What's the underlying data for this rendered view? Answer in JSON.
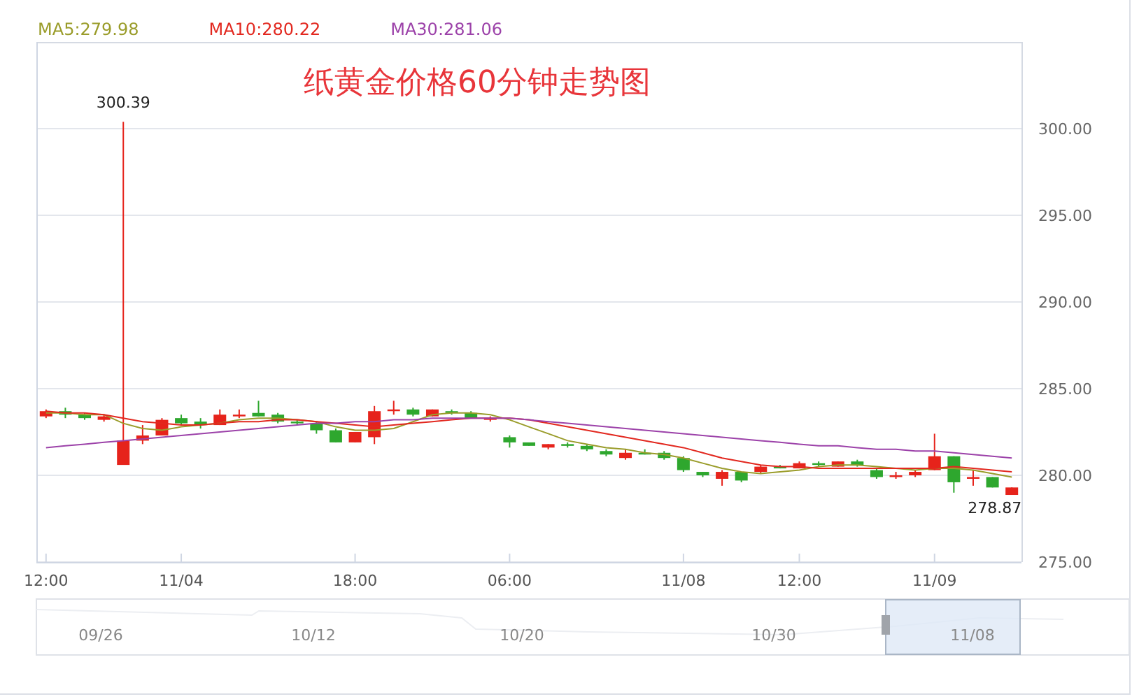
{
  "chart_data": {
    "type": "candlestick",
    "title": "纸黄金价格60分钟走势图",
    "grid": true,
    "ylim": [
      275,
      305
    ],
    "yticks": [
      {
        "value": 275,
        "label": "275.00"
      },
      {
        "value": 280,
        "label": "280.00"
      },
      {
        "value": 285,
        "label": "285.00"
      },
      {
        "value": 290,
        "label": "290.00"
      },
      {
        "value": 295,
        "label": "295.00"
      },
      {
        "value": 300,
        "label": "300.00"
      }
    ],
    "categories": [
      "12:00",
      null,
      null,
      null,
      null,
      null,
      null,
      "11/04",
      null,
      null,
      null,
      null,
      null,
      null,
      null,
      null,
      "18:00",
      null,
      null,
      null,
      null,
      null,
      null,
      null,
      "06:00",
      null,
      null,
      null,
      null,
      null,
      null,
      null,
      null,
      "11/08",
      null,
      null,
      null,
      null,
      null,
      "12:00",
      null,
      null,
      null,
      null,
      null,
      null,
      "11/09",
      null,
      null,
      null,
      null
    ],
    "ohlc": [
      [
        283.4,
        283.8,
        283.3,
        283.7
      ],
      [
        283.7,
        283.9,
        283.3,
        283.5
      ],
      [
        283.5,
        283.6,
        283.2,
        283.3
      ],
      [
        283.2,
        283.5,
        283.1,
        283.4
      ],
      [
        280.6,
        300.39,
        280.6,
        282.0
      ],
      [
        282.0,
        282.9,
        281.8,
        282.3
      ],
      [
        282.3,
        283.3,
        282.3,
        283.2
      ],
      [
        283.3,
        283.5,
        282.9,
        283.0
      ],
      [
        283.1,
        283.3,
        282.7,
        282.9
      ],
      [
        282.9,
        283.8,
        282.9,
        283.5
      ],
      [
        283.4,
        283.8,
        283.3,
        283.5
      ],
      [
        283.6,
        284.3,
        283.4,
        283.4
      ],
      [
        283.5,
        283.6,
        283.0,
        283.1
      ],
      [
        283.1,
        283.2,
        282.9,
        283.0
      ],
      [
        283.0,
        283.1,
        282.4,
        282.6
      ],
      [
        282.6,
        282.7,
        281.9,
        281.9
      ],
      [
        281.9,
        282.5,
        281.9,
        282.5
      ],
      [
        282.2,
        284.0,
        281.8,
        283.7
      ],
      [
        283.7,
        284.3,
        283.5,
        283.8
      ],
      [
        283.8,
        283.9,
        283.4,
        283.5
      ],
      [
        283.4,
        283.8,
        283.4,
        283.8
      ],
      [
        283.7,
        283.8,
        283.5,
        283.6
      ],
      [
        283.6,
        283.7,
        283.3,
        283.3
      ],
      [
        283.2,
        283.4,
        283.1,
        283.3
      ],
      [
        282.2,
        282.3,
        281.6,
        281.9
      ],
      [
        281.9,
        281.9,
        281.7,
        281.7
      ],
      [
        281.6,
        281.8,
        281.5,
        281.8
      ],
      [
        281.8,
        281.9,
        281.6,
        281.7
      ],
      [
        281.7,
        281.8,
        281.4,
        281.5
      ],
      [
        281.4,
        281.5,
        281.1,
        281.2
      ],
      [
        281.0,
        281.5,
        280.9,
        281.3
      ],
      [
        281.3,
        281.5,
        281.2,
        281.2
      ],
      [
        281.3,
        281.4,
        280.9,
        281.0
      ],
      [
        281.0,
        281.1,
        280.2,
        280.3
      ],
      [
        280.2,
        280.2,
        279.9,
        280.0
      ],
      [
        279.8,
        280.3,
        279.4,
        280.2
      ],
      [
        280.2,
        280.2,
        279.6,
        279.7
      ],
      [
        280.2,
        280.6,
        280.1,
        280.5
      ],
      [
        280.5,
        280.6,
        280.4,
        280.4
      ],
      [
        280.4,
        280.8,
        280.4,
        280.7
      ],
      [
        280.7,
        280.8,
        280.5,
        280.6
      ],
      [
        280.5,
        280.8,
        280.5,
        280.8
      ],
      [
        280.8,
        280.9,
        280.5,
        280.6
      ],
      [
        280.3,
        280.4,
        279.8,
        279.9
      ],
      [
        279.9,
        280.2,
        279.8,
        280.0
      ],
      [
        280.0,
        280.3,
        279.9,
        280.2
      ],
      [
        280.3,
        282.4,
        280.3,
        281.1
      ],
      [
        281.1,
        281.1,
        279.0,
        279.6
      ],
      [
        279.8,
        280.3,
        279.4,
        279.9
      ],
      [
        279.9,
        279.9,
        279.3,
        279.3
      ],
      [
        278.87,
        279.3,
        278.87,
        279.3
      ]
    ],
    "series": [
      {
        "name": "MA5:279.98",
        "type": "line",
        "color": "#9a9c2a",
        "values": [
          283.6,
          283.6,
          283.5,
          283.5,
          283.0,
          282.7,
          282.6,
          282.8,
          282.9,
          283.0,
          283.2,
          283.3,
          283.3,
          283.2,
          283.1,
          282.8,
          282.6,
          282.6,
          282.7,
          283.1,
          283.5,
          283.6,
          283.6,
          283.5,
          283.2,
          282.8,
          282.4,
          282.0,
          281.8,
          281.6,
          281.5,
          281.3,
          281.2,
          281.0,
          280.7,
          280.4,
          280.2,
          280.1,
          280.2,
          280.3,
          280.5,
          280.6,
          280.6,
          280.5,
          280.4,
          280.3,
          280.4,
          280.4,
          280.3,
          280.1,
          279.9
        ]
      },
      {
        "name": "MA10:280.22",
        "type": "line",
        "color": "#e2281f",
        "values": [
          283.7,
          283.6,
          283.6,
          283.5,
          283.3,
          283.1,
          283.0,
          282.9,
          282.9,
          283.0,
          283.1,
          283.1,
          283.2,
          283.2,
          283.1,
          283.0,
          282.9,
          282.8,
          282.9,
          283.0,
          283.1,
          283.2,
          283.3,
          283.3,
          283.3,
          283.2,
          283.0,
          282.8,
          282.6,
          282.4,
          282.2,
          282.0,
          281.8,
          281.6,
          281.3,
          281.0,
          280.8,
          280.6,
          280.5,
          280.5,
          280.4,
          280.4,
          280.4,
          280.4,
          280.4,
          280.4,
          280.4,
          280.5,
          280.4,
          280.3,
          280.2
        ]
      },
      {
        "name": "MA30:281.06",
        "type": "line",
        "color": "#9c42a9",
        "values": [
          281.6,
          281.7,
          281.8,
          281.9,
          282.0,
          282.1,
          282.2,
          282.3,
          282.4,
          282.5,
          282.6,
          282.7,
          282.8,
          282.9,
          283.0,
          283.0,
          283.1,
          283.1,
          283.2,
          283.2,
          283.3,
          283.3,
          283.3,
          283.3,
          283.3,
          283.2,
          283.1,
          283.0,
          282.9,
          282.8,
          282.7,
          282.6,
          282.5,
          282.4,
          282.3,
          282.2,
          282.1,
          282.0,
          281.9,
          281.8,
          281.7,
          281.7,
          281.6,
          281.5,
          281.5,
          281.4,
          281.4,
          281.3,
          281.2,
          281.1,
          281.0
        ]
      }
    ],
    "annotations": [
      {
        "y": 300.39,
        "text": "300.39"
      },
      "278.87"
    ]
  },
  "navigator": {
    "labels": [
      "09/26",
      "10/12",
      "10/20",
      "10/30",
      "11/08"
    ]
  }
}
